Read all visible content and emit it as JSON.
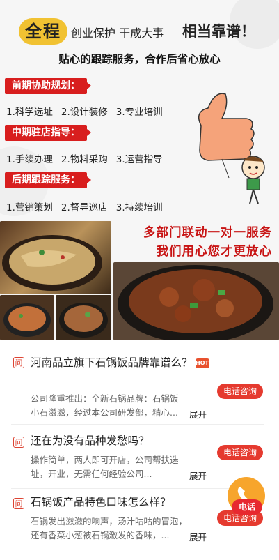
{
  "banner": {
    "badge": "全程",
    "hero_mid": "创业保护  干成大事",
    "hero_big": "相当靠谱！",
    "subtitle": "贴心的跟踪服务，合作后省心放心",
    "sections": [
      {
        "tag": "前期协助规划：",
        "items": [
          "1.科学选址",
          "2.设计装修",
          "3.专业培训"
        ]
      },
      {
        "tag": "中期驻店指导：",
        "items": [
          "1.手续办理",
          "2.物料采购",
          "3.运营指导"
        ]
      },
      {
        "tag": "后期跟踪服务：",
        "items": [
          "1.营销策划",
          "2.督导巡店",
          "3.持续培训"
        ]
      }
    ],
    "slogan_1": "多部门联动一对一服务",
    "slogan_2": "我们用心您才更放心"
  },
  "faq": [
    {
      "title": "河南品立旗下石锅饭品牌靠谱么？",
      "hot": "HOT",
      "desc": "公司隆重推出：全新石锅品牌：石锅饭 小石滋滋，经过本公司研发部，精心...",
      "more": "展开",
      "call": "电话咨询"
    },
    {
      "title": "还在为没有品种发愁吗？",
      "desc": "操作简单，两人即可开店，公司帮扶选址，开业，无需任何经验公司...",
      "more": "展开",
      "call": "电话咨询"
    },
    {
      "title": "石锅饭产品特色口味怎么样？",
      "desc": "石锅发出滋滋的响声，汤汁咕咕的冒泡，还有香菜小葱被石锅激发的香味，...",
      "more": "展开",
      "call": "电话咨询"
    }
  ],
  "q_badge": "问",
  "fab": {
    "label": "电话"
  },
  "colors": {
    "accent": "#d81e1e",
    "badge": "#f1c232",
    "call": "#e53a2f"
  }
}
